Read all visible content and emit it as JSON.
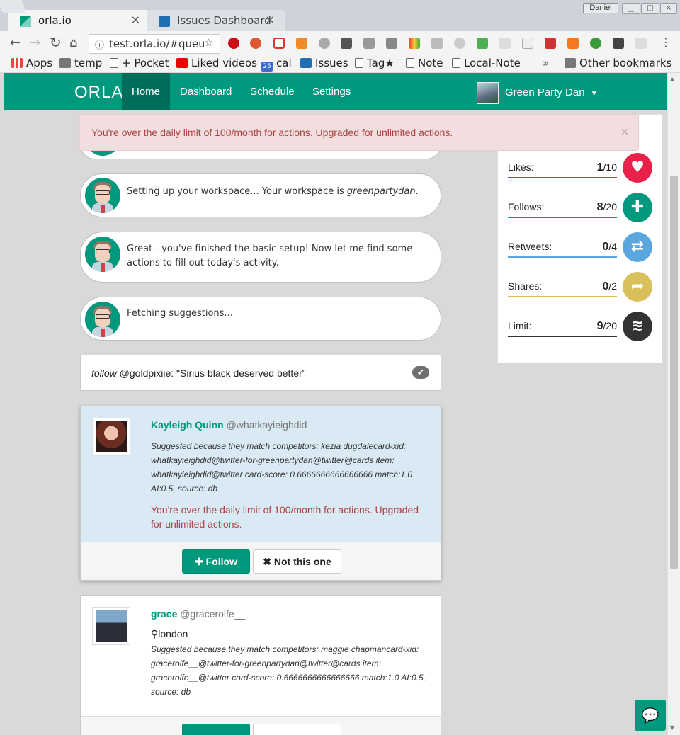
{
  "browser": {
    "tabs": [
      {
        "title": "orla.io",
        "active": true
      },
      {
        "title": "Issues Dashboard",
        "active": false
      }
    ],
    "profile_name": "Daniel",
    "url": "test.orla.io/#queu",
    "bookmarks": [
      "Apps",
      "temp",
      "+ Pocket",
      "Liked videos",
      "cal",
      "Issues",
      "Tag★",
      "Note",
      "Local-Note",
      "»",
      "Other bookmarks"
    ],
    "cal_badge": "25"
  },
  "app": {
    "logo": "ORLA",
    "nav": [
      "Home",
      "Dashboard",
      "Schedule",
      "Settings"
    ],
    "active_nav": "Home",
    "user_name": "Green Party Dan",
    "brand_color": "#00997e"
  },
  "alert": {
    "message": "You're over the daily limit of 100/month for actions. Upgraded for unlimited actions.",
    "close": "×"
  },
  "bubbles": [
    {
      "text_before": "Setting up your workspace... Your workspace is ",
      "text_em": "greenpartydan",
      "text_after": "."
    },
    {
      "text": "Great - you've finished the basic setup! Now let me find some actions to fill out today's activity."
    },
    {
      "text": "Fetching suggestions..."
    }
  ],
  "current_action": {
    "verb": "follow",
    "rest": " @goldpixiie: \"Sirius black deserved better\""
  },
  "stats": [
    {
      "label": "Likes:",
      "value": "1",
      "max": "/10",
      "color": "#e8204a",
      "icon": "heart-icon"
    },
    {
      "label": "Follows:",
      "value": "8",
      "max": "/20",
      "color": "#00997e",
      "icon": "plus-icon"
    },
    {
      "label": "Retweets:",
      "value": "0",
      "max": "/4",
      "color": "#5aa7e0",
      "icon": "retweet-icon"
    },
    {
      "label": "Shares:",
      "value": "0",
      "max": "/2",
      "color": "#d9c05a",
      "icon": "share-icon"
    },
    {
      "label": "Limit:",
      "value": "9",
      "max": "/20",
      "color": "#333333",
      "icon": "layers-icon"
    }
  ],
  "cards": [
    {
      "name": "Kayleigh Quinn",
      "handle": "@whatkayieighdid",
      "location": "",
      "reason": "Suggested because they match competitors: kezia dugdalecard-xid: whatkayieighdid@twitter-for-greenpartydan@twitter@cards item: whatkayieighdid@twitter card-score: 0.6666666666666666 match:1.0 AI:0.5, source: db",
      "error": "You're over the daily limit of 100/month for actions. Upgraded for unlimited actions.",
      "follow_label": "Follow",
      "skip_label": "Not this one"
    },
    {
      "name": "grace",
      "handle": "@gracerolfe__",
      "location": "london",
      "reason": "Suggested because they match competitors: maggie chapmancard-xid: gracerolfe__@twitter-for-greenpartydan@twitter@cards item: gracerolfe__@twitter card-score: 0.6666666666666666 match:1.0 AI:0.5, source: db"
    }
  ]
}
